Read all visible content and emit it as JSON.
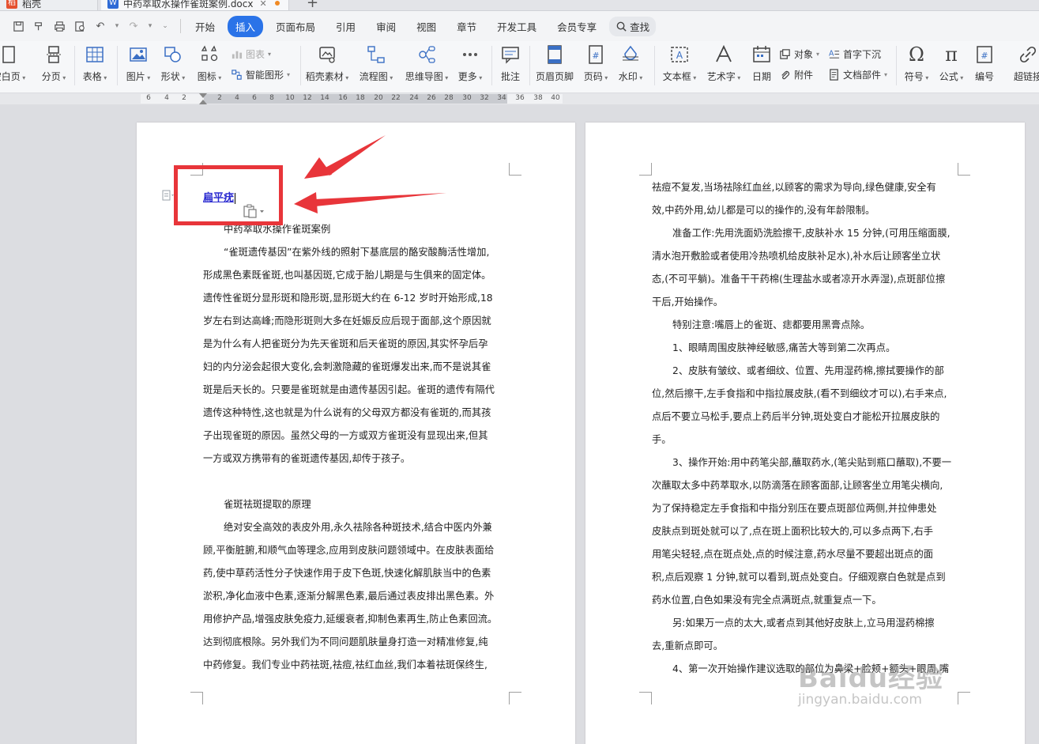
{
  "tabs": {
    "app": {
      "label": "稻壳"
    },
    "doc": {
      "label": "中药萃取水操作雀斑案例.docx"
    },
    "add_label": "+"
  },
  "menu": {
    "items": [
      "开始",
      "插入",
      "页面布局",
      "引用",
      "审阅",
      "视图",
      "章节",
      "开发工具",
      "会员专享"
    ],
    "active": "插入",
    "search_label": "查找"
  },
  "ribbon": {
    "blank_page": "空白页",
    "section_break": "分页",
    "table": "表格",
    "picture": "图片",
    "shape": "形状",
    "icon": "图标",
    "chart": "图表",
    "smart_shape": "智能图形",
    "daoke_material": "稻壳素材",
    "flowchart": "流程图",
    "mindmap": "思维导图",
    "more": "更多",
    "comment": "批注",
    "header_footer": "页眉页脚",
    "page_number": "页码",
    "watermark": "水印",
    "textbox": "文本框",
    "wordart": "艺术字",
    "date": "日期",
    "object": "对象",
    "attachment": "附件",
    "dropcap": "首字下沉",
    "doc_parts": "文档部件",
    "symbol": "符号",
    "formula": "公式",
    "numbering": "编号",
    "hyperlink": "超链接"
  },
  "ruler": {
    "ticks": [
      "6",
      "4",
      "2",
      "2",
      "4",
      "6",
      "8",
      "10",
      "12",
      "14",
      "16",
      "18",
      "20",
      "22",
      "24",
      "26",
      "28",
      "30",
      "32",
      "34",
      "36",
      "38",
      "40"
    ]
  },
  "left_page": {
    "heading": "扁平疣",
    "lines": [
      {
        "text": "中药萃取水操作雀斑案例",
        "indent": true
      },
      {
        "text": "“雀斑遗传基因”在紫外线的照射下基底层的酪安酸酶活性增加,",
        "indent": true
      },
      {
        "text": "形成黑色素既雀斑,也叫基因斑,它成于胎儿期是与生俱来的固定体。",
        "indent": false
      },
      {
        "text": "遗传性雀斑分显形斑和隐形斑,显形斑大约在 6-12 岁时开始形成,18",
        "indent": false
      },
      {
        "text": "岁左右到达高峰;而隐形斑则大多在妊娠反应后现于面部,这个原因就",
        "indent": false
      },
      {
        "text": "是为什么有人把雀斑分为先天雀斑和后天雀斑的原因,其实怀孕后孕",
        "indent": false
      },
      {
        "text": "妇的内分泌会起很大变化,会刺激隐藏的雀斑爆发出来,而不是说其雀",
        "indent": false
      },
      {
        "text": "斑是后天长的。只要是雀斑就是由遗传基因引起。雀斑的遗传有隔代",
        "indent": false
      },
      {
        "text": "遗传这种特性,这也就是为什么说有的父母双方都没有雀斑的,而其孩",
        "indent": false
      },
      {
        "text": "子出现雀斑的原因。虽然父母的一方或双方雀斑没有显现出来,但其",
        "indent": false
      },
      {
        "text": "一方或双方携带有的雀斑遗传基因,却传于孩子。",
        "indent": false
      },
      {
        "text": "",
        "indent": false
      },
      {
        "text": "雀斑祛斑提取的原理",
        "indent": true
      },
      {
        "text": "绝对安全高效的表皮外用,永久祛除各种斑技术,结合中医内外兼",
        "indent": true
      },
      {
        "text": "顾,平衡脏腑,和顺气血等理念,应用到皮肤问题领域中。在皮肤表面给",
        "indent": false
      },
      {
        "text": "药,使中草药活性分子快速作用于皮下色斑,快速化解肌肤当中的色素",
        "indent": false
      },
      {
        "text": "淤积,净化血液中色素,逐渐分解黑色素,最后通过表皮排出黑色素。外",
        "indent": false
      },
      {
        "text": "用修护产品,增强皮肤免疫力,延缓衰者,抑制色素再生,防止色素回流。",
        "indent": false
      },
      {
        "text": "达到彻底根除。另外我们为不同问题肌肤量身打造一对精准修复,纯",
        "indent": false
      },
      {
        "text": "中药修复。我们专业中药祛斑,祛痘,祛红血丝,我们本着祛斑保终生,",
        "indent": false
      }
    ]
  },
  "right_page": {
    "lines": [
      {
        "text": "祛痘不复发,当场祛除红血丝,以顾客的需求为导向,绿色健康,安全有",
        "indent": false
      },
      {
        "text": "效,中药外用,幼儿都是可以的操作的,没有年龄限制。",
        "indent": false
      },
      {
        "text": "准备工作:先用洗面奶洗脸擦干,皮肤补水 15 分钟,(可用压缩面膜,",
        "indent": true
      },
      {
        "text": "清水泡开敷脸或者使用冷热喷机给皮肤补足水),补水后让顾客坐立状",
        "indent": false
      },
      {
        "text": "态,(不可平躺)。准备干干药棉(生理盐水或者凉开水弄湿),点斑部位擦",
        "indent": false
      },
      {
        "text": "干后,开始操作。",
        "indent": false
      },
      {
        "text": "特别注意:嘴唇上的雀斑、痣都要用黑膏点除。",
        "indent": true
      },
      {
        "text": "1、眼睛周围皮肤神经敏感,痛苦大等到第二次再点。",
        "indent": true
      },
      {
        "text": "2、皮肤有皱纹、或者细纹、位置、先用湿药棉,擦拭要操作的部",
        "indent": true
      },
      {
        "text": "位,然后擦干,左手食指和中指拉展皮肤,(看不到细纹才可以),右手来点,",
        "indent": false
      },
      {
        "text": "点后不要立马松手,要点上药后半分钟,斑处变白才能松开拉展皮肤的",
        "indent": false
      },
      {
        "text": "手。",
        "indent": false
      },
      {
        "text": "3、操作开始:用中药笔尖部,蘸取药水,(笔尖贴到瓶口蘸取),不要一",
        "indent": true
      },
      {
        "text": "次蘸取太多中药萃取水,以防滴落在顾客面部,让顾客坐立用笔尖横向,",
        "indent": false
      },
      {
        "text": "为了保持稳定左手食指和中指分别压在要点斑部位两侧,并拉伸患处",
        "indent": false
      },
      {
        "text": "皮肤点到斑处就可以了,点在斑上面积比较大的,可以多点两下,右手",
        "indent": false
      },
      {
        "text": "用笔尖轻轻,点在斑点处,点的时候注意,药水尽量不要超出斑点的面",
        "indent": false
      },
      {
        "text": "积,点后观察 1 分钟,就可以看到,斑点处变白。仔细观察白色就是点到",
        "indent": false
      },
      {
        "text": "药水位置,白色如果没有完全点满斑点,就重复点一下。",
        "indent": false
      },
      {
        "text": "另:如果万一点的太大,或者点到其他好皮肤上,立马用湿药棉擦",
        "indent": true
      },
      {
        "text": "去,重新点即可。",
        "indent": false
      },
      {
        "text": "4、第一次开始操作建议选取的部位为鼻梁+脸颊+额头+眼周,嘴",
        "indent": true
      }
    ]
  },
  "watermark": {
    "brand": "Baidu经验",
    "url": "jingyan.baidu.com"
  },
  "colors": {
    "accent": "#2a73e8",
    "highlight": "#e8353a",
    "heading": "#2a2ad0"
  }
}
